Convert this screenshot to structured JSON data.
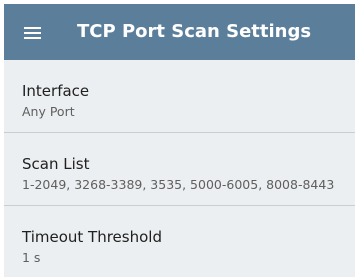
{
  "app_bar": {
    "title": "TCP Port Scan Settings",
    "menu_icon": "hamburger-menu-icon",
    "background_color": "#5b7e9b"
  },
  "settings": [
    {
      "title": "Interface",
      "value": "Any Port"
    },
    {
      "title": "Scan List",
      "value": "1-2049, 3268-3389, 3535, 5000-6005, 8008-8443"
    },
    {
      "title": "Timeout Threshold",
      "value": "1 s"
    }
  ]
}
